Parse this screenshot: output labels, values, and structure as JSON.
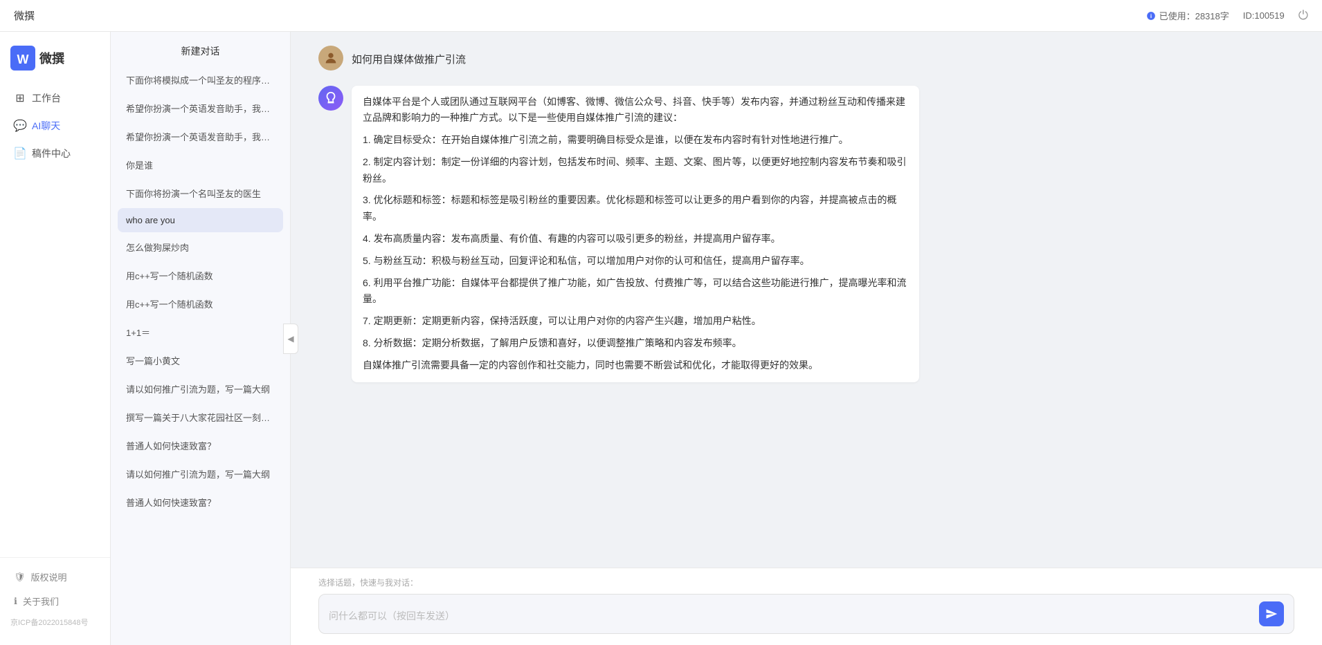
{
  "header": {
    "title": "微撰",
    "usage_label": "已使用：28318字",
    "usage_icon": "info-icon",
    "id_label": "ID:100519",
    "logout_icon": "power-icon"
  },
  "sidebar": {
    "logo_text": "微撰",
    "nav_items": [
      {
        "id": "workbench",
        "label": "工作台",
        "icon": "grid-icon"
      },
      {
        "id": "ai-chat",
        "label": "AI聊天",
        "icon": "chat-icon",
        "active": true
      },
      {
        "id": "drafts",
        "label": "稿件中心",
        "icon": "file-icon"
      }
    ],
    "bottom_items": [
      {
        "id": "copyright",
        "label": "版权说明",
        "icon": "shield-icon"
      },
      {
        "id": "about",
        "label": "关于我们",
        "icon": "info-circle-icon"
      }
    ],
    "icp": "京ICP备2022015848号"
  },
  "chat_list": {
    "new_chat_label": "新建对话",
    "items": [
      {
        "id": 1,
        "text": "下面你将模拟成一个叫圣友的程序员，我说...",
        "active": false
      },
      {
        "id": 2,
        "text": "希望你扮演一个英语发音助手，我提供给你...",
        "active": false
      },
      {
        "id": 3,
        "text": "希望你扮演一个英语发音助手，我提供给你...",
        "active": false
      },
      {
        "id": 4,
        "text": "你是谁",
        "active": false
      },
      {
        "id": 5,
        "text": "下面你将扮演一个名叫圣友的医生",
        "active": false
      },
      {
        "id": 6,
        "text": "who are you",
        "active": true
      },
      {
        "id": 7,
        "text": "怎么做狗屎炒肉",
        "active": false
      },
      {
        "id": 8,
        "text": "用c++写一个随机函数",
        "active": false
      },
      {
        "id": 9,
        "text": "用c++写一个随机函数",
        "active": false
      },
      {
        "id": 10,
        "text": "1+1＝",
        "active": false
      },
      {
        "id": 11,
        "text": "写一篇小黄文",
        "active": false
      },
      {
        "id": 12,
        "text": "请以如何推广引流为题，写一篇大纲",
        "active": false
      },
      {
        "id": 13,
        "text": "撰写一篇关于八大家花园社区一刻钟便民生...",
        "active": false
      },
      {
        "id": 14,
        "text": "普通人如何快速致富？",
        "active": false
      },
      {
        "id": 15,
        "text": "请以如何推广引流为题，写一篇大纲",
        "active": false
      },
      {
        "id": 16,
        "text": "普通人如何快速致富？",
        "active": false
      }
    ]
  },
  "chat": {
    "messages": [
      {
        "role": "user",
        "avatar_type": "user",
        "avatar_text": "👤",
        "content": "如何用自媒体做推广引流"
      },
      {
        "role": "ai",
        "avatar_type": "ai",
        "avatar_text": "AI",
        "content_paragraphs": [
          "自媒体平台是个人或团队通过互联网平台（如博客、微博、微信公众号、抖音、快手等）发布内容，并通过粉丝互动和传播来建立品牌和影响力的一种推广方式。以下是一些使用自媒体推广引流的建议：",
          "1. 确定目标受众：在开始自媒体推广引流之前，需要明确目标受众是谁，以便在发布内容时有针对性地进行推广。",
          "2. 制定内容计划：制定一份详细的内容计划，包括发布时间、频率、主题、文案、图片等，以便更好地控制内容发布节奏和吸引粉丝。",
          "3. 优化标题和标签：标题和标签是吸引粉丝的重要因素。优化标题和标签可以让更多的用户看到你的内容，并提高被点击的概率。",
          "4. 发布高质量内容：发布高质量、有价值、有趣的内容可以吸引更多的粉丝，并提高用户留存率。",
          "5. 与粉丝互动：积极与粉丝互动，回复评论和私信，可以增加用户对你的认可和信任，提高用户留存率。",
          "6. 利用平台推广功能：自媒体平台都提供了推广功能，如广告投放、付费推广等，可以结合这些功能进行推广，提高曝光率和流量。",
          "7. 定期更新：定期更新内容，保持活跃度，可以让用户对你的内容产生兴趣，增加用户粘性。",
          "8. 分析数据：定期分析数据，了解用户反馈和喜好，以便调整推广策略和内容发布频率。",
          "自媒体推广引流需要具备一定的内容创作和社交能力，同时也需要不断尝试和优化，才能取得更好的效果。"
        ]
      }
    ],
    "input_hint": "选择话题，快速与我对话：",
    "input_placeholder": "问什么都可以（按回车发送）",
    "send_icon": "send-icon"
  }
}
